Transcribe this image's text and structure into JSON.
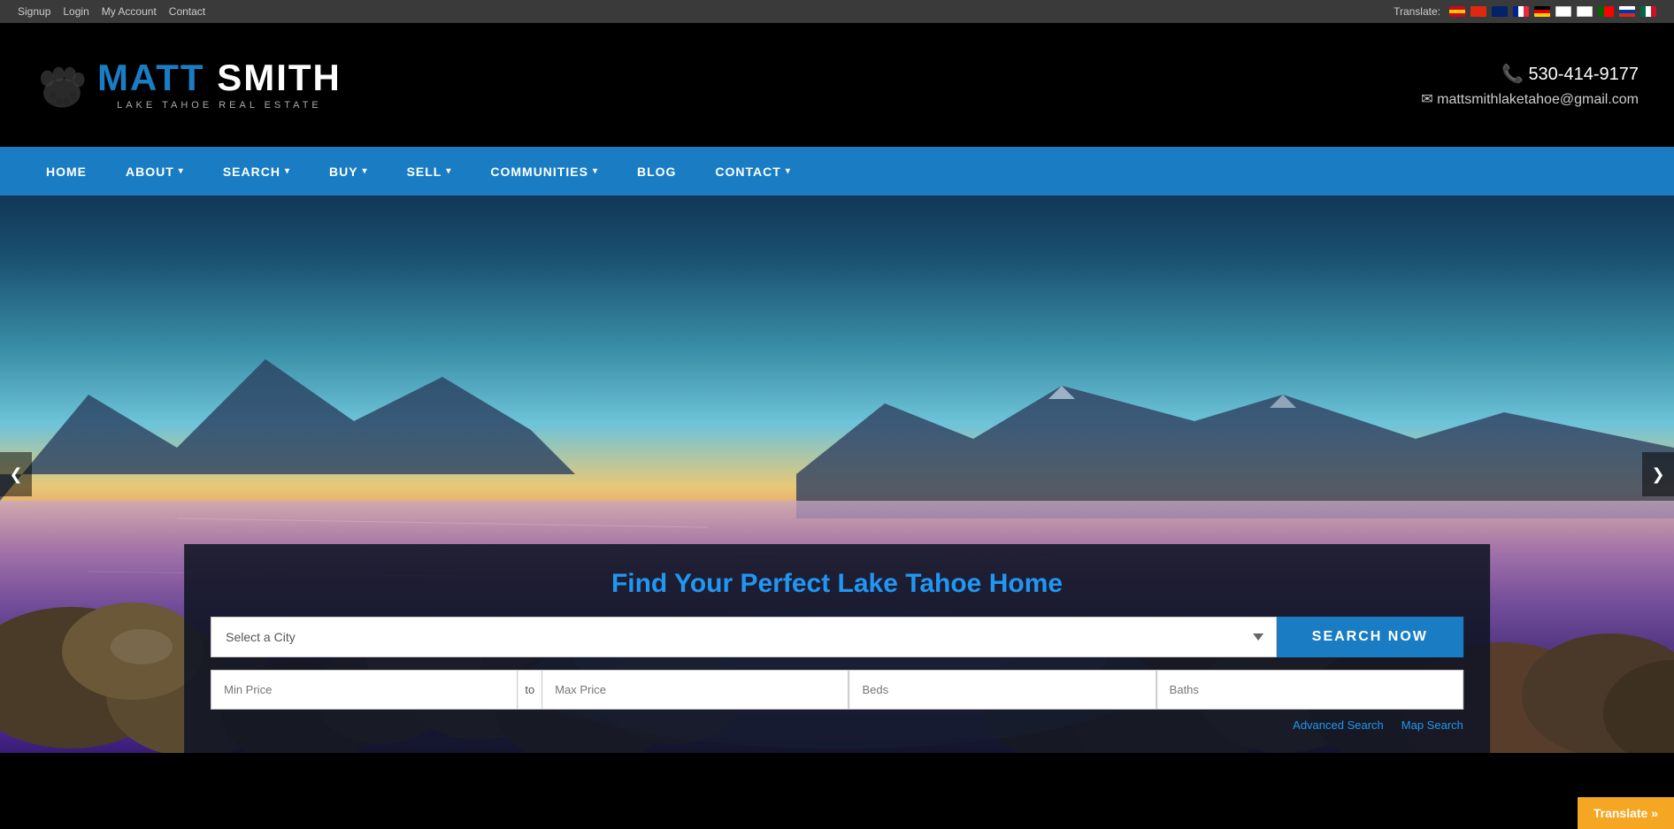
{
  "topbar": {
    "signup": "Signup",
    "login": "Login",
    "myaccount": "My Account",
    "contact": "Contact",
    "translate_label": "Translate:"
  },
  "header": {
    "logo_matt": "MATT",
    "logo_smith": "SMITH",
    "logo_subtitle": "LAKE TAHOE  REAL ESTATE",
    "phone": "530-414-9177",
    "email": "mattsmithlaketahoe@gmail.com"
  },
  "nav": {
    "items": [
      {
        "label": "HOME",
        "has_arrow": false
      },
      {
        "label": "ABOUT",
        "has_arrow": true
      },
      {
        "label": "SEARCH",
        "has_arrow": true
      },
      {
        "label": "BUY",
        "has_arrow": true
      },
      {
        "label": "SELL",
        "has_arrow": true
      },
      {
        "label": "COMMUNITIES",
        "has_arrow": true
      },
      {
        "label": "BLOG",
        "has_arrow": false
      },
      {
        "label": "CONTACT",
        "has_arrow": true
      }
    ]
  },
  "hero": {
    "prev_arrow": "❮",
    "next_arrow": "❯"
  },
  "search": {
    "title": "Find Your Perfect Lake Tahoe Home",
    "city_placeholder": "Select a City",
    "min_price_placeholder": "Min Price",
    "price_to": "to",
    "max_price_placeholder": "Max Price",
    "beds_placeholder": "Beds",
    "baths_placeholder": "Baths",
    "search_btn": "SEARCH NOW",
    "advanced_search": "Advanced Search",
    "map_search": "Map Search"
  },
  "translate": {
    "label": "Translate »"
  },
  "flags": [
    {
      "name": "spanish",
      "class": "flag-es"
    },
    {
      "name": "chinese",
      "class": "flag-cn"
    },
    {
      "name": "english-uk",
      "class": "flag-uk"
    },
    {
      "name": "french",
      "class": "flag-fr"
    },
    {
      "name": "german",
      "class": "flag-de"
    },
    {
      "name": "japanese",
      "class": "flag-jp"
    },
    {
      "name": "korean",
      "class": "flag-kr"
    },
    {
      "name": "portuguese",
      "class": "flag-pt"
    },
    {
      "name": "russian",
      "class": "flag-ru"
    },
    {
      "name": "mexican",
      "class": "flag-mx"
    }
  ]
}
